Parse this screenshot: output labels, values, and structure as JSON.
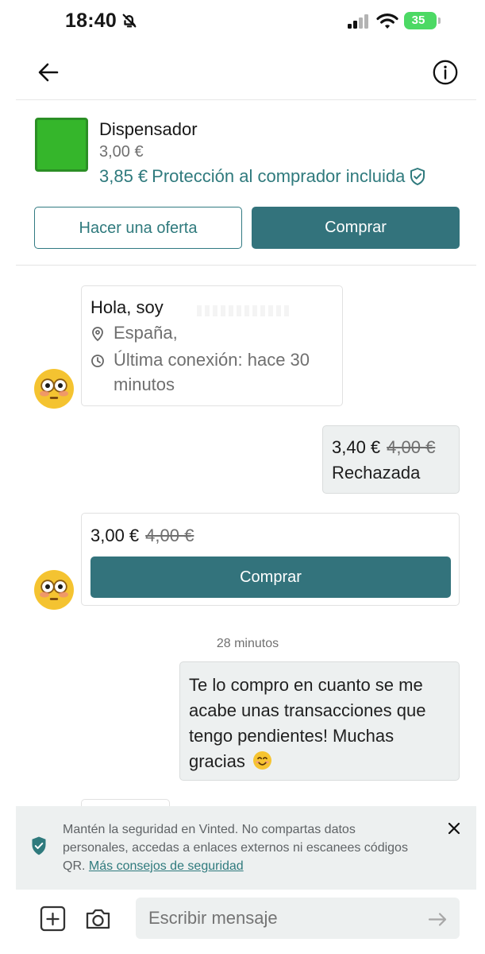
{
  "status_bar": {
    "time": "18:40",
    "battery_percent": "35",
    "icons": [
      "bell-off-icon",
      "signal-icon",
      "wifi-icon",
      "battery-icon"
    ]
  },
  "header": {
    "back_icon": "arrow-left-icon",
    "info_icon": "info-icon"
  },
  "item": {
    "title": "Dispensador",
    "price": "3,00 €",
    "total_price": "3,85 €",
    "protection_text": "Protección al comprador incluida",
    "thumbnail_color": "#35b62b",
    "offer_button": "Hacer una oferta",
    "buy_button": "Comprar"
  },
  "chat": {
    "profile": {
      "greeting": "Hola, soy",
      "location": "España,",
      "last_seen": "Última conexión: hace 30 minutos"
    },
    "sent_offer": {
      "price": "3,40 €",
      "original_price": "4,00 €",
      "status": "Rechazada"
    },
    "received_offer": {
      "price": "3,00 €",
      "original_price": "4,00 €",
      "buy_button": "Comprar"
    },
    "timestamp": "28 minutos",
    "message": {
      "text": "Te lo compro en cuanto se me acabe unas transacciones que tengo pendientes! Muchas gracias",
      "emoji": "smiling-face-emoji"
    }
  },
  "safety": {
    "text": "Mantén la seguridad en Vinted. No compartas datos personales, accedas a enlaces externos ni escanees códigos QR.",
    "link": "Más consejos de seguridad"
  },
  "composer": {
    "placeholder": "Escribir mensaje"
  },
  "colors": {
    "accent": "#33737c",
    "text_teal": "#2f7a7d",
    "bubble_gray": "#edf0f0"
  }
}
